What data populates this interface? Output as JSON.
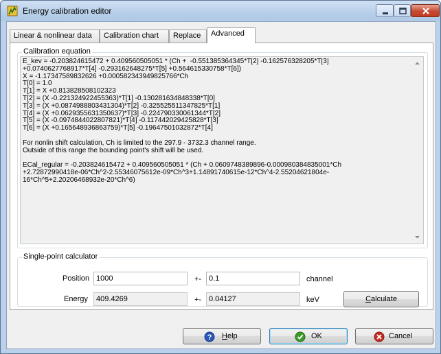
{
  "window": {
    "title": "Energy calibration editor",
    "icon": "calibration-app-icon"
  },
  "tabs": [
    {
      "label": "Linear & nonlinear data"
    },
    {
      "label": "Calibration chart"
    },
    {
      "label": "Replace"
    },
    {
      "label": "Advanced"
    }
  ],
  "active_tab": "Advanced",
  "calibration": {
    "group_label": "Calibration equation",
    "text": "E_kev = -0.203824615472 + 0.409560505051 * (Ch +  -0.551385364345*T[2] -0.162576328205*T[3]\n+0.0740627768917*T[4] -0.293162648275*T[5] +0.564615330758*T[6])\nX = -1.17347589832626 +0.000582343949825766*Ch\nT[0] = 1.0\nT[1] = X +0.813828508102323\nT[2] = (X -0.221324922455363)*T[1] -0.130281634848338*T[0]\nT[3] = (X +0.0874988803431304)*T[2] -0.325525511347825*T[1]\nT[4] = (X +0.0629355631350637)*T[3] -0.224790330061344*T[2]\nT[5] = (X -0.0974844022807821)*T[4] -0.117442029425828*T[3]\nT[6] = (X +0.165648936863759)*T[5] -0.19647501032872*T[4]\n\nFor nonlin shift calculation, Ch is limited to the 297.9 - 3732.3 channel range.\nOutside of this range the bounding point's shift will be used.\n\nECal_regular = -0.203824615472 + 0.409560505051 * (Ch + 0.0609748389896-0.000980384835001*Ch\n+2.72872990418e-06*Ch^2-2.55346075612e-09*Ch^3+1.14891740615e-12*Ch^4-2.55204621804e-\n16*Ch^5+2.20206468932e-20*Ch^6)"
  },
  "calculator": {
    "group_label": "Single-point calculator",
    "position_label": "Position",
    "position_value": "1000",
    "position_pm": "+-",
    "position_error": "0.1",
    "position_unit": "channel",
    "energy_label": "Energy",
    "energy_value": "409.4269",
    "energy_pm": "+-",
    "energy_error": "0.04127",
    "energy_unit": "keV",
    "calculate_label": "Calculate",
    "calculate_accel": "C",
    "calculate_rest": "alculate"
  },
  "footer": {
    "help_accel": "H",
    "help_rest": "elp",
    "ok_label": "OK",
    "cancel_label": "Cancel"
  },
  "colors": {
    "frame": "#b9d1ea",
    "close_button": "#c74a33",
    "help_icon": "#2a57b8",
    "ok_icon": "#3d9b2a",
    "cancel_icon": "#c42a22"
  }
}
